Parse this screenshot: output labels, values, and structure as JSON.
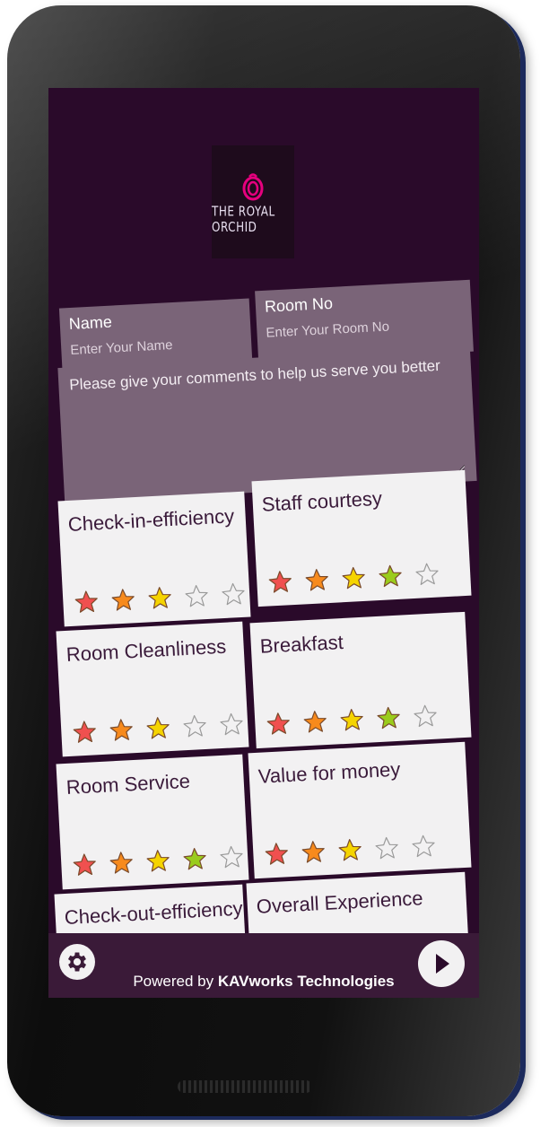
{
  "app": {
    "logo_text": "THE ROYAL ORCHID",
    "brand_color": "#e6007e"
  },
  "form": {
    "name_label": "Name",
    "name_placeholder": "Enter Your Name",
    "room_label": "Room No",
    "room_placeholder": "Enter Your Room No",
    "comments_placeholder": "Please give your comments to help us serve you better"
  },
  "ratings": [
    {
      "label": "Check-in-efficiency",
      "rating": 3
    },
    {
      "label": "Staff courtesy",
      "rating": 4
    },
    {
      "label": "Room Cleanliness",
      "rating": 3
    },
    {
      "label": "Breakfast",
      "rating": 4
    },
    {
      "label": "Room Service",
      "rating": 4
    },
    {
      "label": "Value for money",
      "rating": 3
    },
    {
      "label": "Check-out-efficiency",
      "rating": 0
    },
    {
      "label": "Overall Experience",
      "rating": 0
    }
  ],
  "star_colors": [
    "#f0504f",
    "#f78a1c",
    "#f5d400",
    "#9acc1c",
    "#9acc1c"
  ],
  "footer": {
    "powered_prefix": "Powered by ",
    "powered_company": "KAVworks Technologies"
  },
  "icons": {
    "settings": "gear-icon",
    "next": "play-arrow-icon"
  }
}
